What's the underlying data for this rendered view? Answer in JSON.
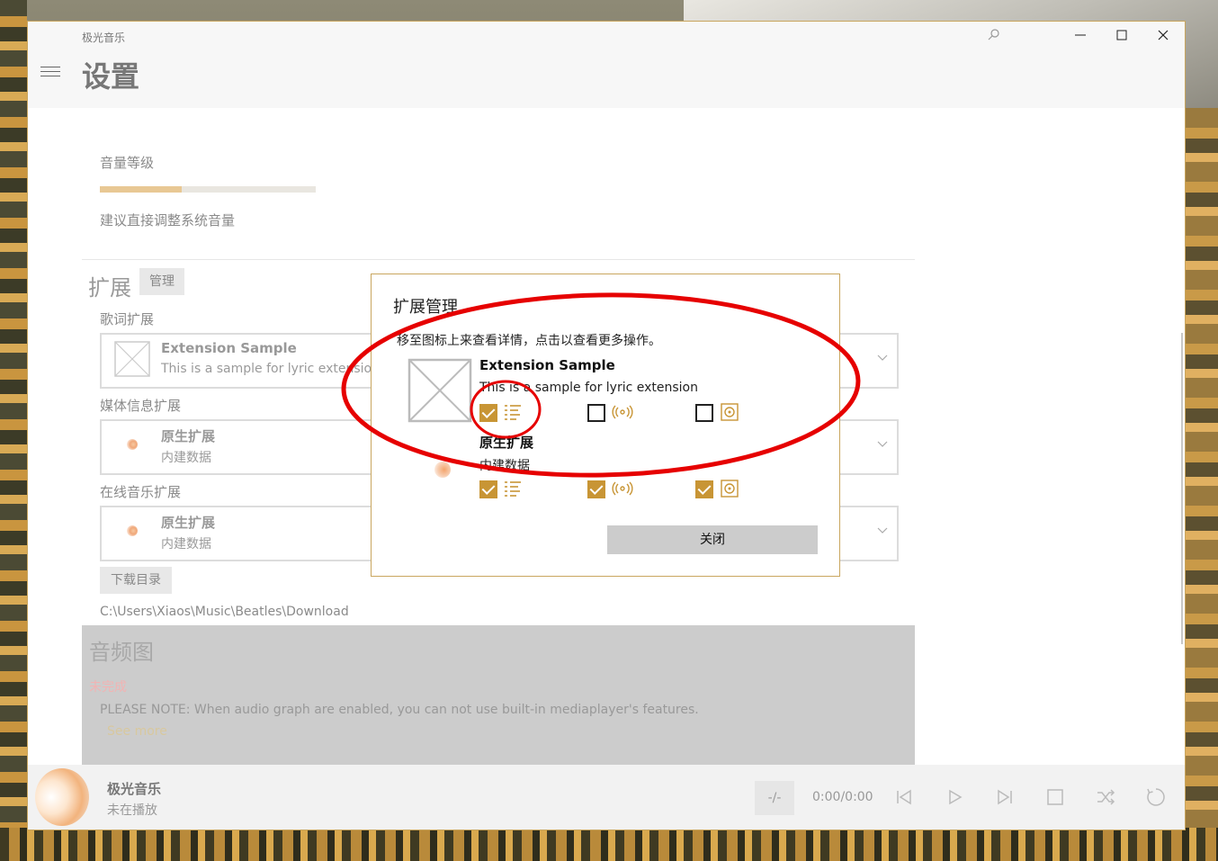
{
  "window": {
    "app_name": "极光音乐",
    "page_title": "设置"
  },
  "volume": {
    "label": "音量等级",
    "level_percent": 38,
    "hint": "建议直接调整系统音量"
  },
  "extensions": {
    "heading": "扩展",
    "manage_label": "管理",
    "groups": [
      {
        "label": "歌词扩展",
        "name": "Extension Sample",
        "desc": "This is a sample for lyric extension"
      },
      {
        "label": "媒体信息扩展",
        "name": "原生扩展",
        "desc": "内建数据"
      },
      {
        "label": "在线音乐扩展",
        "name": "原生扩展",
        "desc": "内建数据"
      }
    ]
  },
  "download": {
    "button_label": "下载目录",
    "path": "C:\\Users\\Xiaos\\Music\\Beatles\\Download"
  },
  "audio_graph": {
    "heading": "音频图",
    "status": "未完成",
    "note": "PLEASE NOTE: When audio graph are enabled, you can not use built-in mediaplayer's features.",
    "more_link": "See more"
  },
  "player": {
    "title": "极光音乐",
    "status": "未在播放",
    "rate": "-/-",
    "time": "0:00/0:00"
  },
  "dialog": {
    "title": "扩展管理",
    "hint": "移至图标上来查看详情，点击以查看更多操作。",
    "close_label": "关闭",
    "items": [
      {
        "name": "Extension Sample",
        "desc": "This is a sample for lyric extension",
        "lyric": true,
        "online": false,
        "media": false
      },
      {
        "name": "原生扩展",
        "desc": "内建数据",
        "lyric": true,
        "online": true,
        "media": true
      }
    ]
  },
  "colors": {
    "accent": "#c89535",
    "annotation": "#e60000",
    "overlay": "#ffffff"
  },
  "icons": [
    "search-icon",
    "minimize-icon",
    "maximize-icon",
    "close-icon",
    "hamburger-icon",
    "lyric-list-icon",
    "radio-icon",
    "media-disc-icon",
    "previous-icon",
    "play-icon",
    "next-icon",
    "stop-icon",
    "shuffle-icon",
    "repeat-icon"
  ]
}
